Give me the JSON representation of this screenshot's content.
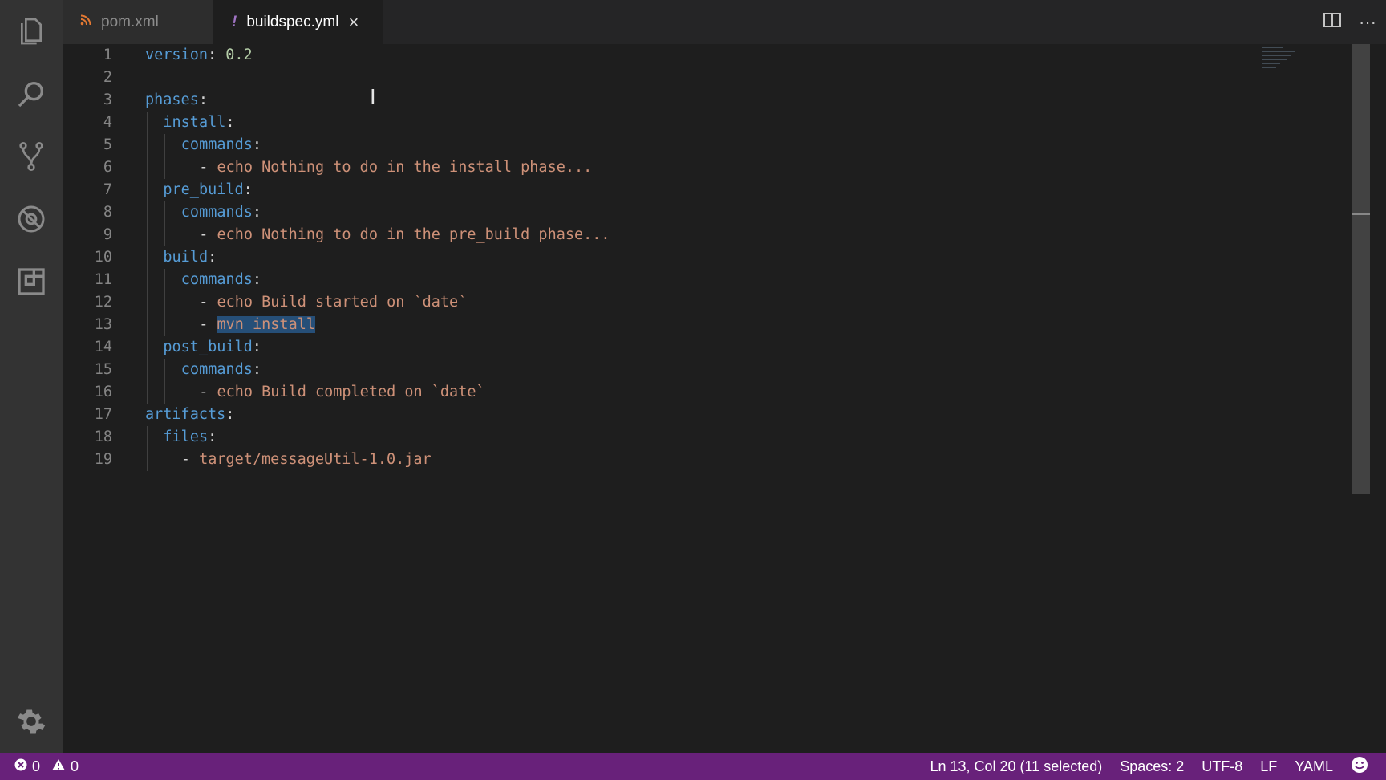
{
  "tabs": [
    {
      "label": "pom.xml",
      "icon": "rss-icon",
      "active": false
    },
    {
      "label": "buildspec.yml",
      "icon": "!",
      "active": true,
      "close": "×"
    }
  ],
  "tab_actions": {
    "split": "⊟",
    "more": "···"
  },
  "code_lines": [
    {
      "num": "1",
      "key": "version",
      "value": "0.2",
      "indent": 0
    },
    {
      "num": "2"
    },
    {
      "num": "3",
      "key": "phases",
      "indent": 0
    },
    {
      "num": "4",
      "key": "install",
      "indent": 1
    },
    {
      "num": "5",
      "key": "commands",
      "indent": 2
    },
    {
      "num": "6",
      "item": "echo Nothing to do in the install phase...",
      "indent": 3
    },
    {
      "num": "7",
      "key": "pre_build",
      "indent": 1
    },
    {
      "num": "8",
      "key": "commands",
      "indent": 2
    },
    {
      "num": "9",
      "item": "echo Nothing to do in the pre_build phase...",
      "indent": 3
    },
    {
      "num": "10",
      "key": "build",
      "indent": 1
    },
    {
      "num": "11",
      "key": "commands",
      "indent": 2
    },
    {
      "num": "12",
      "item": "echo Build started on `date`",
      "indent": 3
    },
    {
      "num": "13",
      "item": "mvn install",
      "indent": 3,
      "selected": true
    },
    {
      "num": "14",
      "key": "post_build",
      "indent": 1
    },
    {
      "num": "15",
      "key": "commands",
      "indent": 2
    },
    {
      "num": "16",
      "item": "echo Build completed on `date`",
      "indent": 3
    },
    {
      "num": "17",
      "key": "artifacts",
      "indent": 0
    },
    {
      "num": "18",
      "key": "files",
      "indent": 1
    },
    {
      "num": "19",
      "item": "target/messageUtil-1.0.jar",
      "indent": 2
    }
  ],
  "status": {
    "errors": "0",
    "warnings": "0",
    "position": "Ln 13, Col 20 (11 selected)",
    "spaces": "Spaces: 2",
    "encoding": "UTF-8",
    "eol": "LF",
    "language": "YAML"
  },
  "colors": {
    "status_bar": "#68217a",
    "key": "#569cd6",
    "string": "#ce9178",
    "number": "#b5cea8",
    "selection": "#264f78"
  }
}
